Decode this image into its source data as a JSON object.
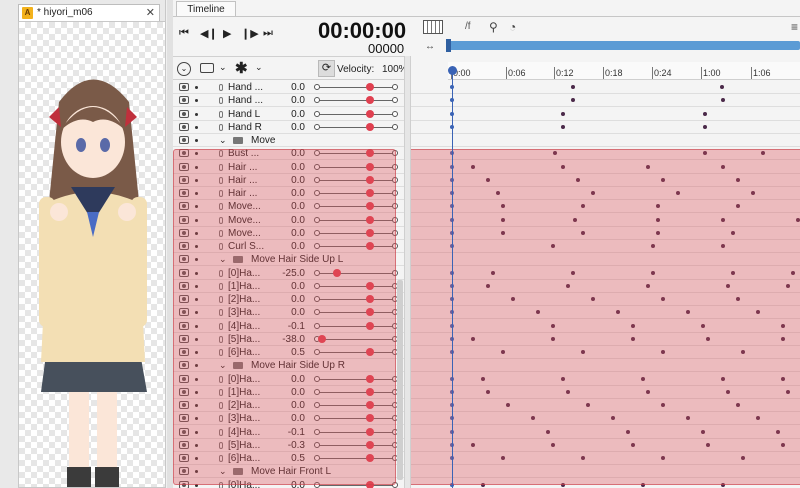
{
  "document": {
    "title": "* hiyori_m06",
    "icon_letter": "A"
  },
  "timeline": {
    "tab_label": "Timeline",
    "time": "00:00:00",
    "frame": "00000",
    "velocity_label": "Velocity:",
    "velocity_value": "100%",
    "fps_label": "/f",
    "ruler_ticks": [
      "0:00",
      "0:06",
      "0:12",
      "0:18",
      "0:24",
      "1:00",
      "1:06"
    ]
  },
  "rows": [
    {
      "type": "param",
      "label": "Hand ...",
      "value": "0.0",
      "kf": [
        120,
        269
      ]
    },
    {
      "type": "param",
      "label": "Hand ...",
      "value": "0.0",
      "kf": [
        120,
        270
      ]
    },
    {
      "type": "param",
      "label": "Hand L",
      "value": "0.0",
      "kf": [
        110,
        252
      ]
    },
    {
      "type": "param",
      "label": "Hand R",
      "value": "0.0",
      "kf": [
        110,
        252
      ]
    },
    {
      "type": "folder",
      "label": "Move"
    },
    {
      "type": "param",
      "label": "Bust ...",
      "value": "0.0",
      "kf": [
        102,
        252,
        310
      ]
    },
    {
      "type": "param",
      "label": "Hair ...",
      "value": "0.0",
      "kf": [
        20,
        110,
        195,
        270,
        350
      ]
    },
    {
      "type": "param",
      "label": "Hair ...",
      "value": "0.0",
      "kf": [
        35,
        125,
        210,
        285
      ]
    },
    {
      "type": "param",
      "label": "Hair ...",
      "value": "0.0",
      "kf": [
        45,
        140,
        225,
        300
      ]
    },
    {
      "type": "param",
      "label": "Move...",
      "value": "0.0",
      "kf": [
        50,
        130,
        205,
        285,
        355
      ]
    },
    {
      "type": "param",
      "label": "Move...",
      "value": "0.0",
      "kf": [
        50,
        122,
        205,
        270,
        345
      ]
    },
    {
      "type": "param",
      "label": "Move...",
      "value": "0.0",
      "kf": [
        50,
        130,
        205,
        280,
        350
      ]
    },
    {
      "type": "param",
      "label": "Curl S...",
      "value": "0.0",
      "kf": [
        100,
        200,
        270
      ]
    },
    {
      "type": "folder",
      "label": "Move Hair Side Up L"
    },
    {
      "type": "param",
      "label": "[0]Ha...",
      "value": "-25.0",
      "kf": [
        40,
        120,
        200,
        280,
        340
      ]
    },
    {
      "type": "param",
      "label": "[1]Ha...",
      "value": "0.0",
      "kf": [
        35,
        115,
        195,
        275,
        335
      ]
    },
    {
      "type": "param",
      "label": "[2]Ha...",
      "value": "0.0",
      "kf": [
        60,
        140,
        210,
        285
      ]
    },
    {
      "type": "param",
      "label": "[3]Ha...",
      "value": "0.0",
      "kf": [
        85,
        165,
        235,
        305
      ]
    },
    {
      "type": "param",
      "label": "[4]Ha...",
      "value": "-0.1",
      "kf": [
        100,
        180,
        250,
        330
      ]
    },
    {
      "type": "param",
      "label": "[5]Ha...",
      "value": "-38.0",
      "kf": [
        20,
        100,
        180,
        255,
        330
      ]
    },
    {
      "type": "param",
      "label": "[6]Ha...",
      "value": "0.5",
      "kf": [
        50,
        130,
        210,
        290
      ]
    },
    {
      "type": "folder",
      "label": "Move Hair Side Up R"
    },
    {
      "type": "param",
      "label": "[0]Ha...",
      "value": "0.0",
      "kf": [
        30,
        110,
        190,
        270,
        330
      ]
    },
    {
      "type": "param",
      "label": "[1]Ha...",
      "value": "0.0",
      "kf": [
        35,
        115,
        195,
        275,
        335
      ]
    },
    {
      "type": "param",
      "label": "[2]Ha...",
      "value": "0.0",
      "kf": [
        55,
        135,
        210,
        285
      ]
    },
    {
      "type": "param",
      "label": "[3]Ha...",
      "value": "0.0",
      "kf": [
        80,
        160,
        235,
        305
      ]
    },
    {
      "type": "param",
      "label": "[4]Ha...",
      "value": "-0.1",
      "kf": [
        95,
        175,
        250,
        325
      ]
    },
    {
      "type": "param",
      "label": "[5]Ha...",
      "value": "-0.3",
      "kf": [
        20,
        100,
        180,
        255,
        330
      ]
    },
    {
      "type": "param",
      "label": "[6]Ha...",
      "value": "0.5",
      "kf": [
        50,
        130,
        210,
        290
      ]
    },
    {
      "type": "folder",
      "label": "Move Hair Front L"
    },
    {
      "type": "param",
      "label": "[0]Ha...",
      "value": "0.0",
      "kf": [
        30,
        110,
        190,
        270
      ]
    }
  ],
  "handles": {
    "14": 0.26,
    "19": 0.08
  },
  "colors": {
    "selection": "#e05060",
    "accent": "#5b9bd5",
    "playhead": "#3a63b5",
    "handle": "#e04050"
  }
}
